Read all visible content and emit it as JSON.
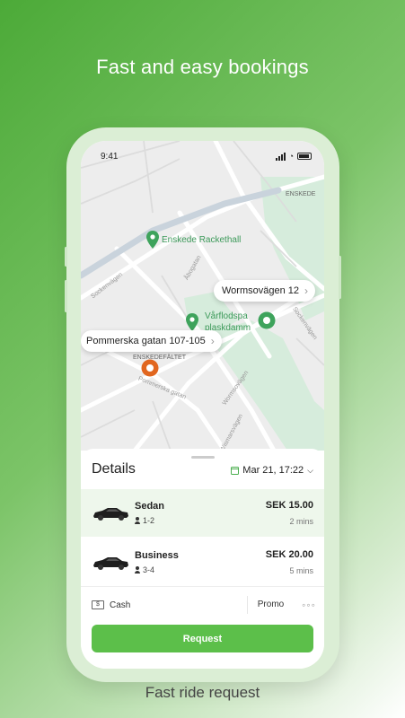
{
  "headline": "Fast and easy bookings",
  "footline": "Fast ride request",
  "status_bar": {
    "time": "9:41"
  },
  "map": {
    "places": {
      "racket_hall": "Enskede Racket­hall",
      "varfloden": "Vårflodspa",
      "plaskdamm": "plaskdamm",
      "enskede": "ENSKEDE",
      "enskedefaltet": "ENSKEDEFÄLTET"
    },
    "streets": {
      "sockenvagen": "Sockenvägen",
      "abogatan": "Åbogatan",
      "pommerska": "Pommerska gatan",
      "wormsovagen": "Wormsovägen",
      "wismarsvagen": "Wismarsvägen",
      "sockenvagen2": "Sockenvägen"
    },
    "callouts": {
      "destination": "Wormsovägen 12",
      "pickup": "Pommerska gatan 107-105"
    },
    "colors": {
      "pin_green": "#3ea35c",
      "pin_orange": "#e1661f",
      "park": "#d6ecdc"
    }
  },
  "details": {
    "title": "Details",
    "date": "Mar 21, 17:22",
    "options": [
      {
        "name": "Sedan",
        "seats": "1-2",
        "price": "SEK 15.00",
        "eta": "2 mins",
        "selected": true
      },
      {
        "name": "Business",
        "seats": "3-4",
        "price": "SEK 20.00",
        "eta": "5 mins",
        "selected": false
      }
    ],
    "payment": {
      "cash_label": "Cash",
      "promo_label": "Promo",
      "more": "◦◦◦"
    },
    "request_label": "Request",
    "accent": "#5cbf4a"
  }
}
